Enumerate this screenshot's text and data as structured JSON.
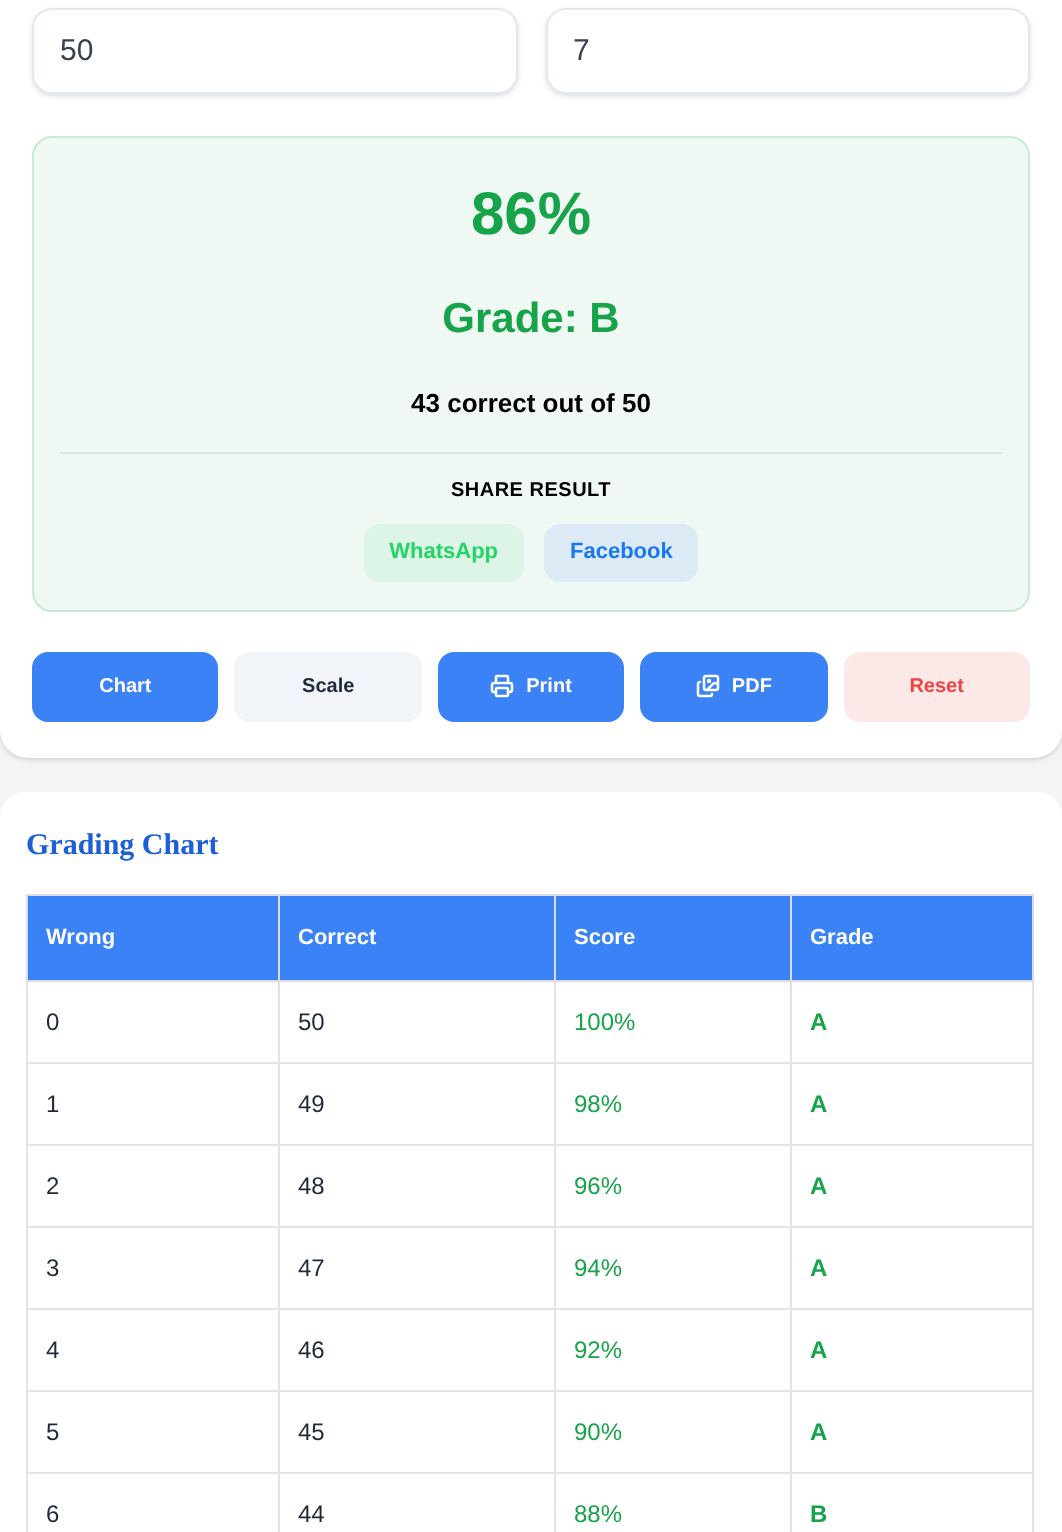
{
  "inputs": [
    {
      "value": "50"
    },
    {
      "value": "7"
    }
  ],
  "result": {
    "score": "86%",
    "grade": "Grade: B",
    "summary": "43 correct out of 50",
    "share_label": "SHARE RESULT",
    "share_buttons": [
      {
        "label": "WhatsApp",
        "kind": "whatsapp"
      },
      {
        "label": "Facebook",
        "kind": "facebook"
      }
    ]
  },
  "actions": [
    {
      "label": "Chart",
      "kind": "chart"
    },
    {
      "label": "Scale",
      "kind": "scale"
    },
    {
      "label": "Print",
      "kind": "print"
    },
    {
      "label": "PDF",
      "kind": "pdf"
    },
    {
      "label": "Reset",
      "kind": "reset"
    }
  ],
  "chart": {
    "title": "Grading Chart",
    "columns": [
      "Wrong",
      "Correct",
      "Score",
      "Grade"
    ],
    "rows": [
      [
        "0",
        "50",
        "100%",
        "A"
      ],
      [
        "1",
        "49",
        "98%",
        "A"
      ],
      [
        "2",
        "48",
        "96%",
        "A"
      ],
      [
        "3",
        "47",
        "94%",
        "A"
      ],
      [
        "4",
        "46",
        "92%",
        "A"
      ],
      [
        "5",
        "45",
        "90%",
        "A"
      ],
      [
        "6",
        "44",
        "88%",
        "B"
      ]
    ]
  }
}
